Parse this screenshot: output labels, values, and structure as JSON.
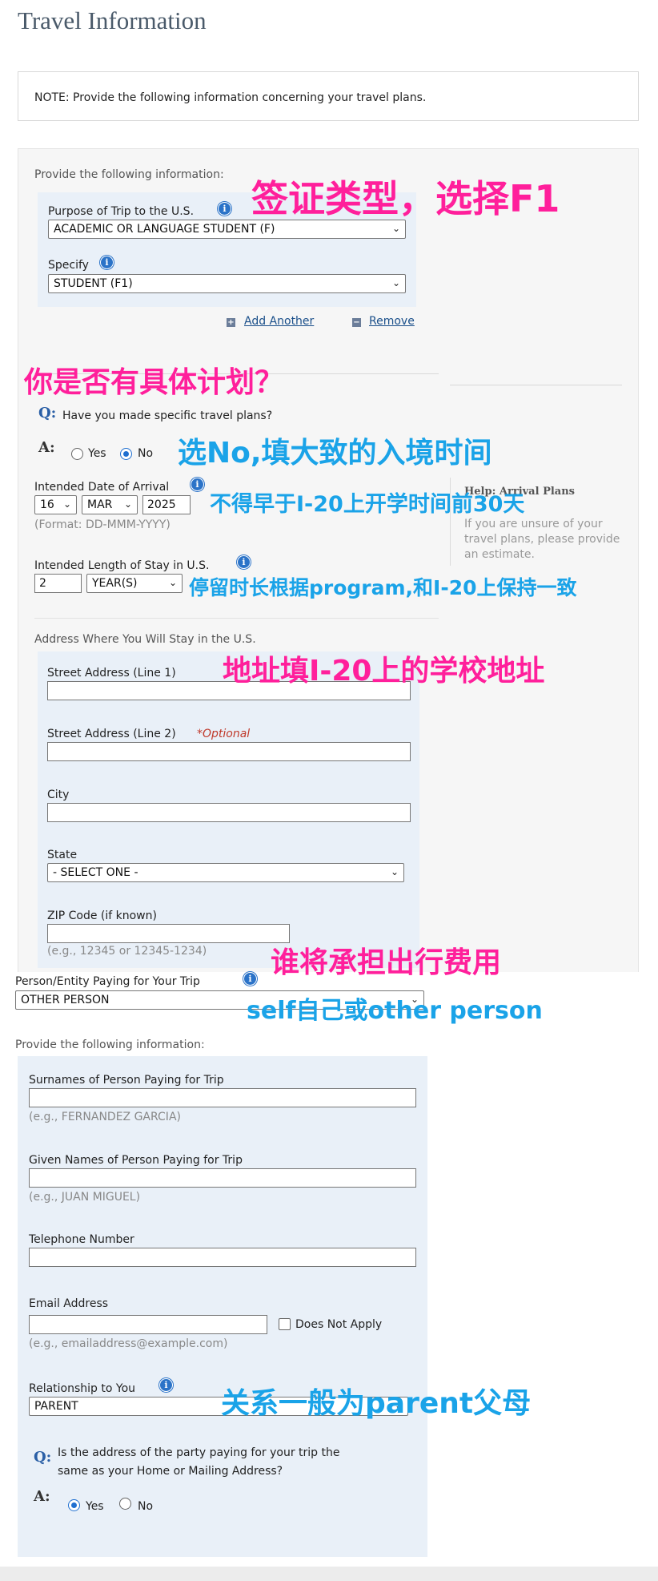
{
  "page": {
    "title": "Travel Information"
  },
  "note": {
    "text": "NOTE: Provide the following information concerning your travel plans."
  },
  "purpose_section": {
    "subtitle": "Provide the following information:",
    "purpose_label": "Purpose of Trip to the U.S.",
    "purpose_value": "ACADEMIC OR LANGUAGE STUDENT (F)",
    "specify_label": "Specify",
    "specify_value": "STUDENT (F1)",
    "add_another": "Add Another",
    "remove": "Remove"
  },
  "plans_section": {
    "q_mark": "Q:",
    "question": "Have you made specific travel plans?",
    "a_mark": "A:",
    "yes": "Yes",
    "no": "No",
    "selected": "No",
    "arrival_label": "Intended Date of Arrival",
    "arrival_day": "16",
    "arrival_month": "MAR",
    "arrival_year": "2025",
    "arrival_format": "(Format: DD-MMM-YYYY)",
    "stay_label": "Intended Length of Stay in U.S.",
    "stay_value": "2",
    "stay_unit": "YEAR(S)",
    "help_title": "Help: Arrival Plans",
    "help_text": "If you are unsure of your travel plans, please provide an estimate."
  },
  "address_section": {
    "title": "Address Where You Will Stay in the U.S.",
    "street1_label": "Street Address (Line 1)",
    "street2_label": "Street Address (Line 2)",
    "optional": "*Optional",
    "city_label": "City",
    "state_label": "State",
    "state_value": "- SELECT ONE -",
    "zip_label": "ZIP Code (if known)",
    "zip_example": "(e.g., 12345 or 12345-1234)"
  },
  "payer_section": {
    "paying_label": "Person/Entity Paying for Your Trip",
    "paying_value": "OTHER PERSON",
    "subtitle": "Provide the following information:",
    "surname_label": "Surnames of Person Paying for Trip",
    "surname_example": "(e.g., FERNANDEZ GARCIA)",
    "given_label": "Given Names of Person Paying for Trip",
    "given_example": "(e.g., JUAN MIGUEL)",
    "phone_label": "Telephone Number",
    "email_label": "Email Address",
    "does_not_apply": "Does Not Apply",
    "email_example": "(e.g., emailaddress@example.com)",
    "relationship_label": "Relationship to You",
    "relationship_value": "PARENT",
    "q_mark": "Q:",
    "address_question_1": "Is the address of the party paying for your trip the",
    "address_question_2": "same as your Home or Mailing Address?",
    "a_mark": "A:",
    "yes": "Yes",
    "no": "No",
    "selected": "Yes"
  },
  "annotations": {
    "visa_type": "签证类型，选择F1",
    "specific_plan": "你是否有具体计划？",
    "choose_no": "选No,填大致的入境时间",
    "not_earlier": "不得早于I-20上开学时间前30天",
    "stay_length": "停留时长根据program,和I-20上保持一致",
    "address": "地址填I-20上的学校地址",
    "who_pays": "谁将承担出行费用",
    "self_or_other": "self自己或other person",
    "relationship": "关系一般为parent父母"
  },
  "colors": {
    "pink": "#ff1f9b",
    "blue": "#1aa3e8",
    "panel": "#e9f0f8"
  },
  "icons": [
    "info-icon",
    "chevron-down-icon",
    "plus-icon",
    "minus-icon",
    "radio-icon",
    "checkbox-icon"
  ]
}
